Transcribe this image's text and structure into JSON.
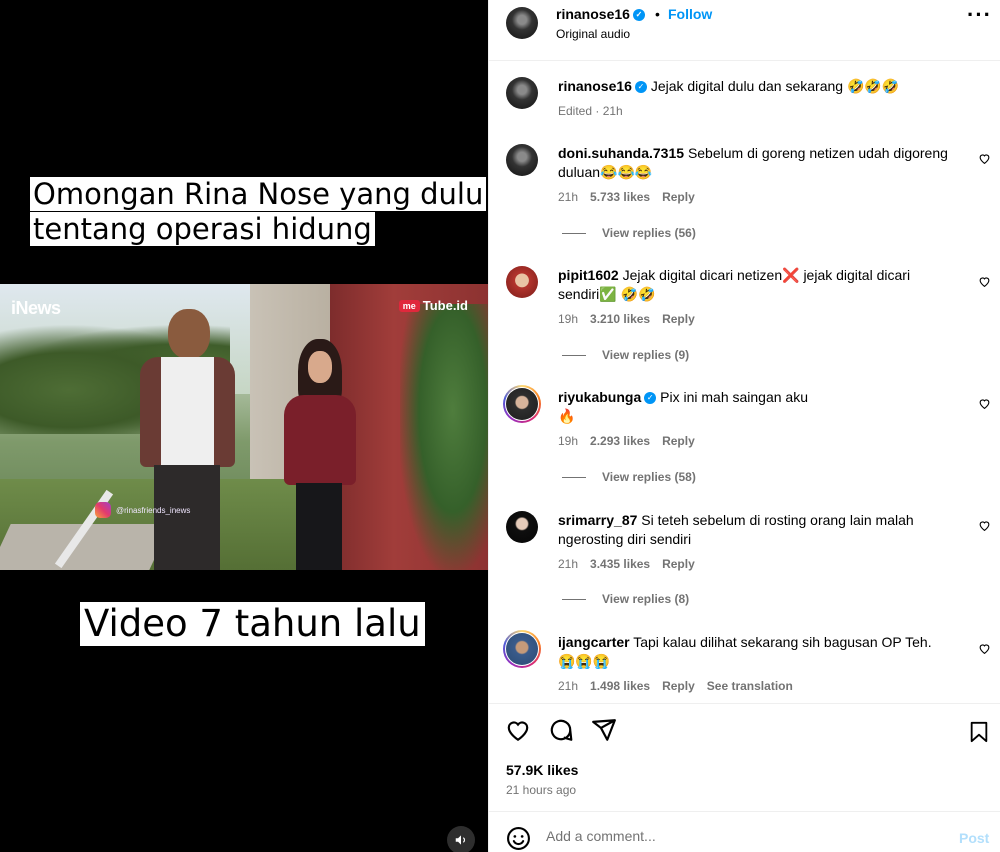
{
  "video": {
    "caption_top_line1": "Omongan Rina Nose yang dulu",
    "caption_top_line2": "tentang operasi hidung",
    "caption_bottom": "Video 7 tahun lalu",
    "watermark_left": "iNews",
    "watermark_right_badge": "me",
    "watermark_right": "Tube.id",
    "ig_handle": "@rinasfriends_inews",
    "mute_icon": "speaker-icon"
  },
  "header": {
    "username": "rinanose16",
    "separator": "•",
    "follow_label": "Follow",
    "audio": "Original audio",
    "more_icon": "more-horizontal-icon"
  },
  "caption_post": {
    "username": "rinanose16",
    "text": "Jejak digital dulu dan sekarang 🤣🤣🤣",
    "meta": "Edited · 21h"
  },
  "comments": [
    {
      "username": "doni.suhanda.7315",
      "text": "Sebelum di goreng netizen udah digoreng duluan😂😂😂",
      "time": "21h",
      "likes": "5.733 likes",
      "reply": "Reply",
      "view_replies": "View replies (56)"
    },
    {
      "username": "pipit1602",
      "text": "Jejak digital dicari netizen❌ jejak digital dicari sendiri✅ 🤣🤣",
      "time": "19h",
      "likes": "3.210 likes",
      "reply": "Reply",
      "view_replies": "View replies (9)"
    },
    {
      "username": "riyukabunga",
      "text": "Pix ini mah saingan aku",
      "text2": "🔥",
      "time": "19h",
      "likes": "2.293 likes",
      "reply": "Reply",
      "view_replies": "View replies (58)"
    },
    {
      "username": "srimarry_87",
      "text": "Si teteh sebelum di rosting orang lain malah ngerosting diri sendiri",
      "time": "21h",
      "likes": "3.435 likes",
      "reply": "Reply",
      "view_replies": "View replies (8)"
    },
    {
      "username": "ijangcarter",
      "text": "Tapi kalau dilihat sekarang sih bagusan OP Teh.",
      "text2": "😭😭😭",
      "time": "21h",
      "likes": "1.498 likes",
      "reply": "Reply",
      "translation": "See translation"
    }
  ],
  "footer": {
    "likes": "57.9K likes",
    "time_ago": "21 hours ago",
    "comment_placeholder": "Add a comment...",
    "post_label": "Post"
  },
  "colors": {
    "accent": "#0095f6",
    "muted": "#737373",
    "post_disabled": "#b2dffc"
  }
}
